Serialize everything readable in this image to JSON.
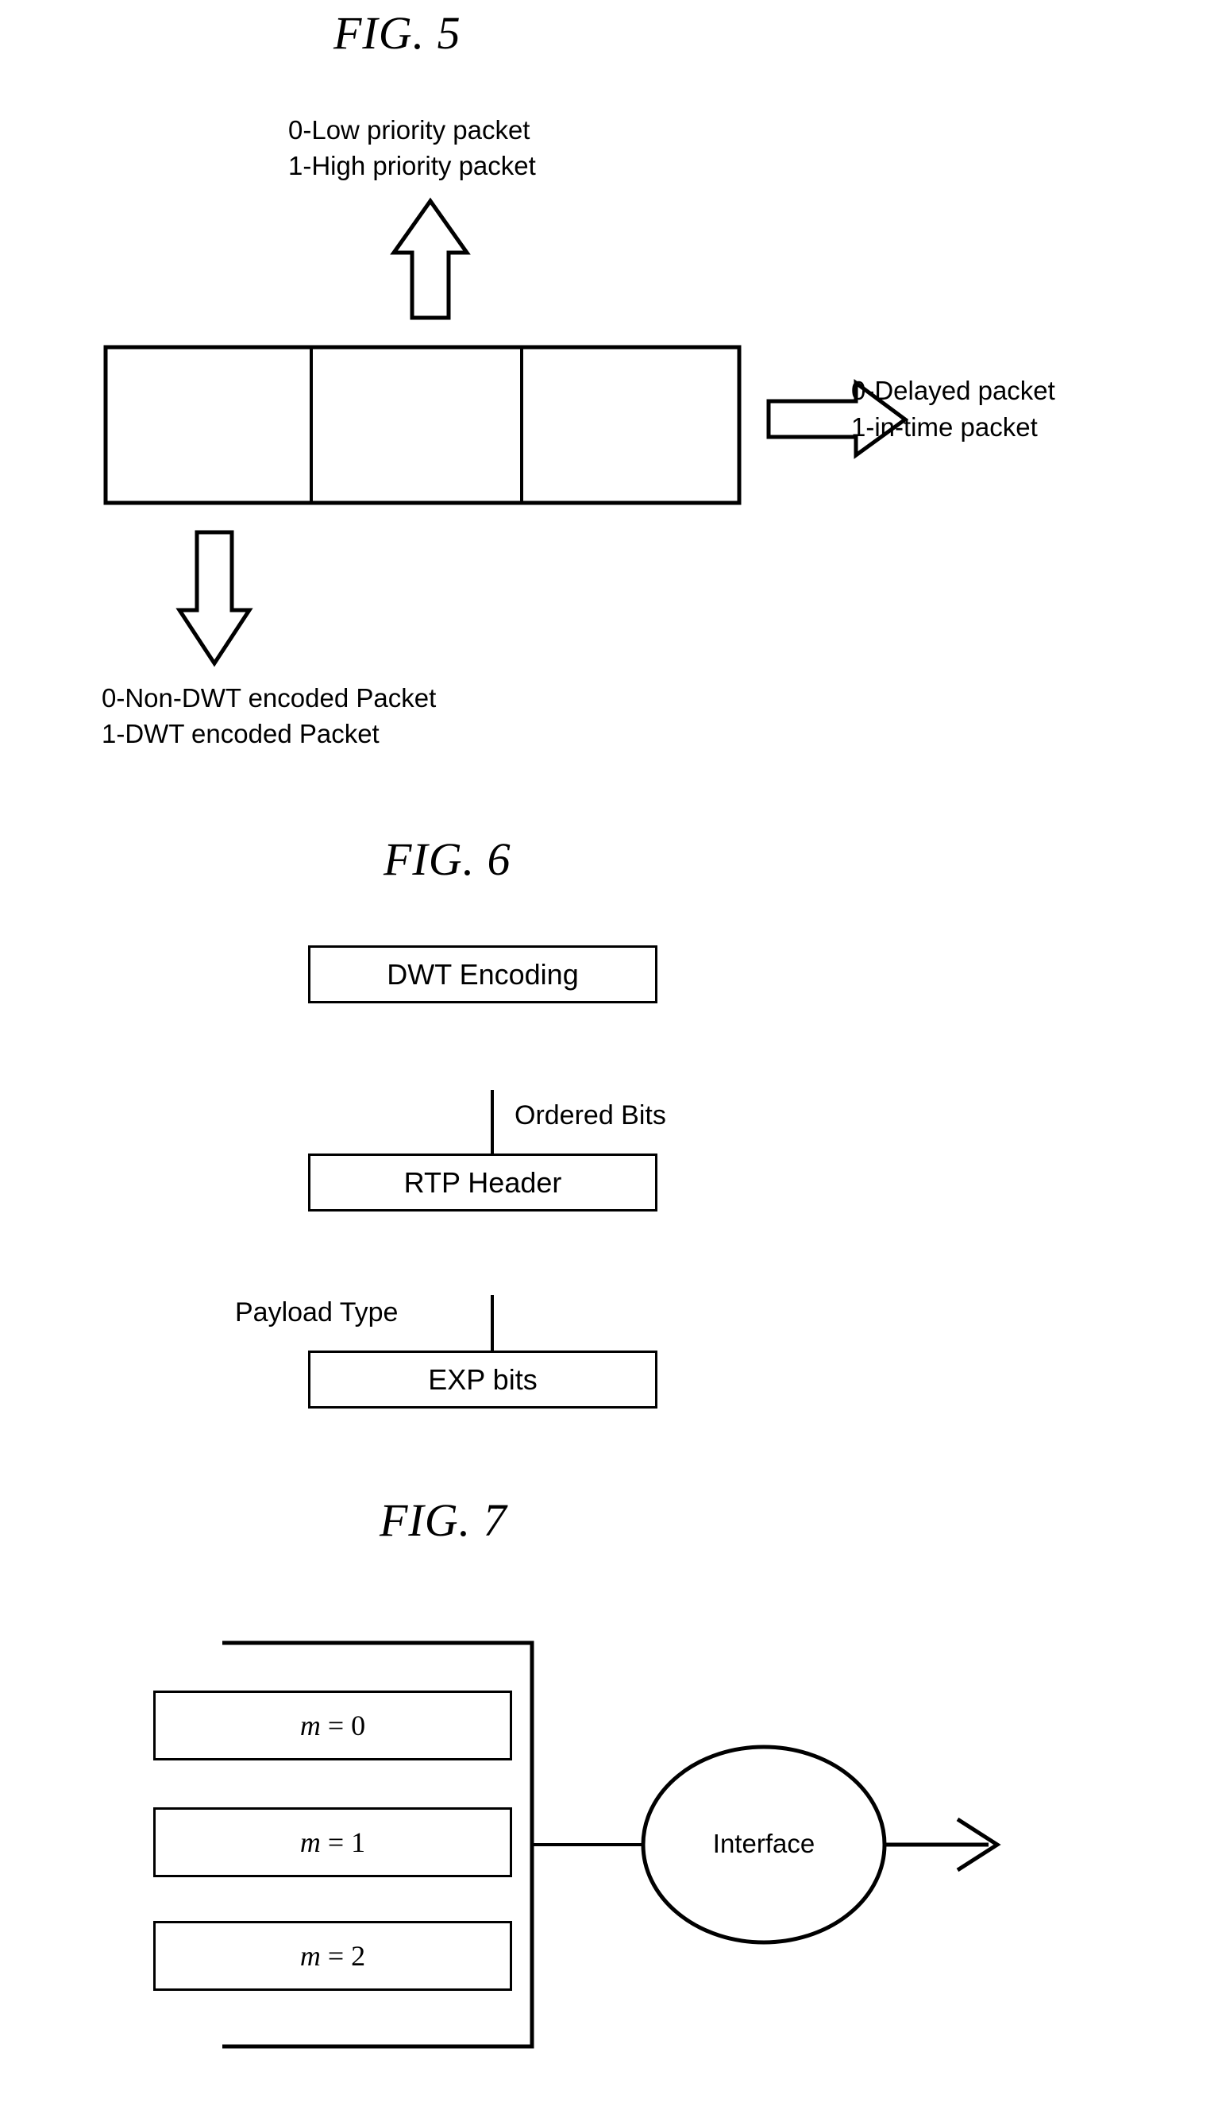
{
  "document": {
    "type": "patent-drawing-sheet",
    "background_color": "#ffffff",
    "ink_color": "#000000"
  },
  "figures": [
    {
      "id": "fig5",
      "title": "FIG. 5",
      "top_label_line1": "0-Low priority packet",
      "top_label_line2": "1-High priority packet",
      "right_label_line1": "0-Delayed packet",
      "right_label_line2": "1-in-time packet",
      "bottom_label_line1": "0-Non-DWT encoded Packet",
      "bottom_label_line2": "1-DWT encoded Packet",
      "cells": [
        "",
        "",
        ""
      ],
      "arrows": [
        "up-block-arrow",
        "right-block-arrow",
        "down-block-arrow"
      ]
    },
    {
      "id": "fig6",
      "title": "FIG. 6",
      "blocks": [
        {
          "label": "DWT Encoding"
        },
        {
          "label": "RTP Header"
        },
        {
          "label": "EXP bits"
        }
      ],
      "edges": [
        {
          "label": "Ordered Bits",
          "position": "right"
        },
        {
          "label": "Payload Type",
          "position": "left"
        }
      ]
    },
    {
      "id": "fig7",
      "title": "FIG. 7",
      "queues": [
        {
          "label_var": "m",
          "label_eq": "=",
          "label_val": "0",
          "label": "m = 0"
        },
        {
          "label_var": "m",
          "label_eq": "=",
          "label_val": "1",
          "label": "m = 1"
        },
        {
          "label_var": "m",
          "label_eq": "=",
          "label_val": "2",
          "label": "m = 2"
        }
      ],
      "node": {
        "label": "Interface",
        "shape": "ellipse"
      },
      "output_arrow": "right-line-arrow"
    }
  ]
}
